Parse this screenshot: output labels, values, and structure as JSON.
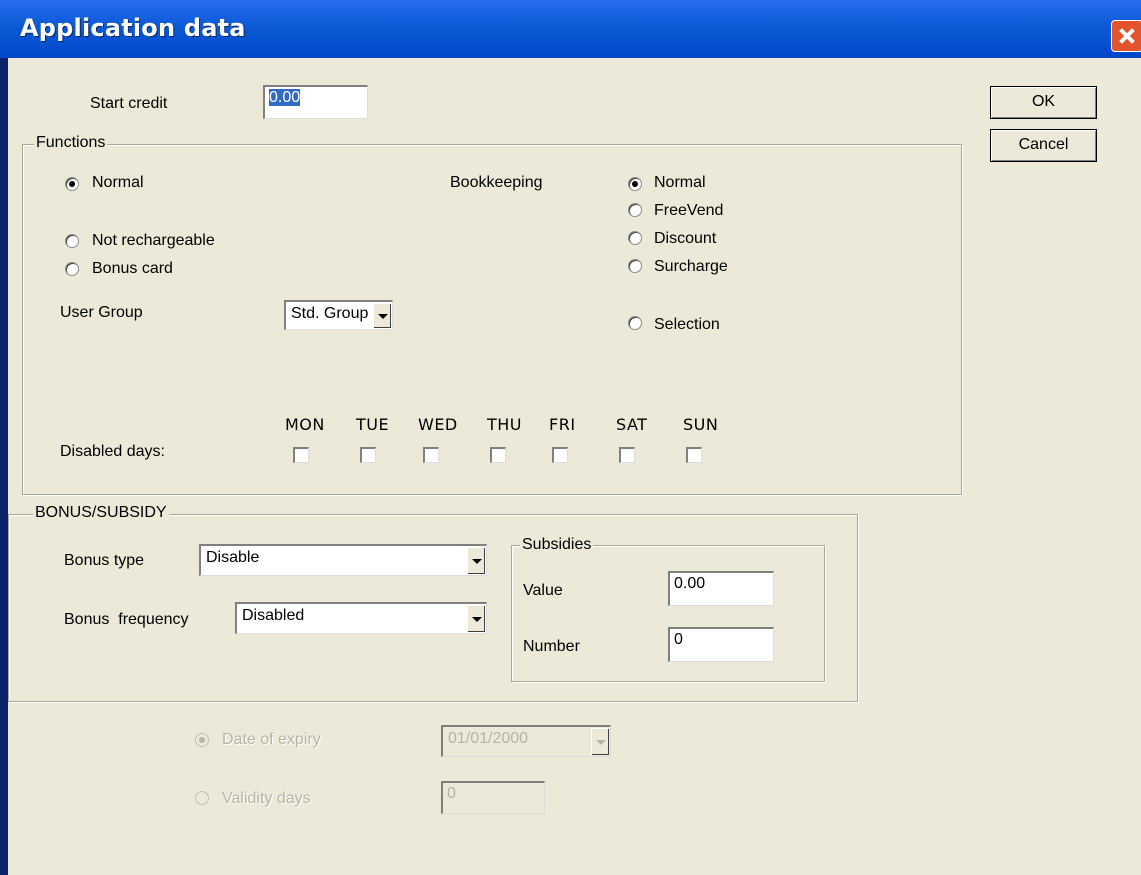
{
  "window": {
    "title": "Application data"
  },
  "buttons": {
    "ok": "OK",
    "cancel": "Cancel"
  },
  "start_credit": {
    "label": "Start credit",
    "value": "0.00"
  },
  "functions": {
    "legend": "Functions",
    "normal": "Normal",
    "not_rechargeable": "Not rechargeable",
    "bonus_card": "Bonus card",
    "user_group_label": "User Group",
    "user_group_value": "Std. Group",
    "bookkeeping_label": "Bookkeeping",
    "bookkeeping_options": [
      "Normal",
      "FreeVend",
      "Discount",
      "Surcharge"
    ],
    "selection": "Selection",
    "disabled_days_label": "Disabled days:",
    "days": [
      "MON",
      "TUE",
      "WED",
      "THU",
      "FRI",
      "SAT",
      "SUN"
    ]
  },
  "bonus": {
    "legend": "BONUS/SUBSIDY",
    "type_label": "Bonus type",
    "type_value": "Disable",
    "freq_label": "Bonus  frequency",
    "freq_value": "Disabled"
  },
  "subsidies": {
    "legend": "Subsidies",
    "value_label": "Value",
    "value": "0.00",
    "number_label": "Number",
    "number": "0"
  },
  "expiry": {
    "date_label": "Date of expiry",
    "date_value": "01/01/2000",
    "validity_label": "Validity days",
    "validity_value": "0"
  },
  "colors": {
    "titlebar": "#0b5ad6",
    "dialog": "#ece9d8",
    "close": "#e2542e"
  }
}
